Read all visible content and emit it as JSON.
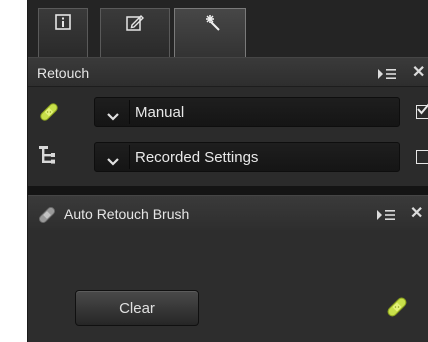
{
  "retouch_panel": {
    "title": "Retouch",
    "rows": [
      {
        "value": "Manual",
        "checked": true,
        "icon": "bandage-icon"
      },
      {
        "value": "Recorded Settings",
        "checked": false,
        "icon": "tree-icon"
      }
    ]
  },
  "auto_retouch_panel": {
    "title": "Auto Retouch Brush",
    "clear_label": "Clear"
  },
  "tabs": [
    {
      "icon": "info-icon"
    },
    {
      "icon": "edit-icon"
    },
    {
      "icon": "magic-wand-icon",
      "active": true
    }
  ],
  "colors": {
    "accent_brush": "#c8e04a",
    "panel_bg": "#2b2b2b"
  }
}
